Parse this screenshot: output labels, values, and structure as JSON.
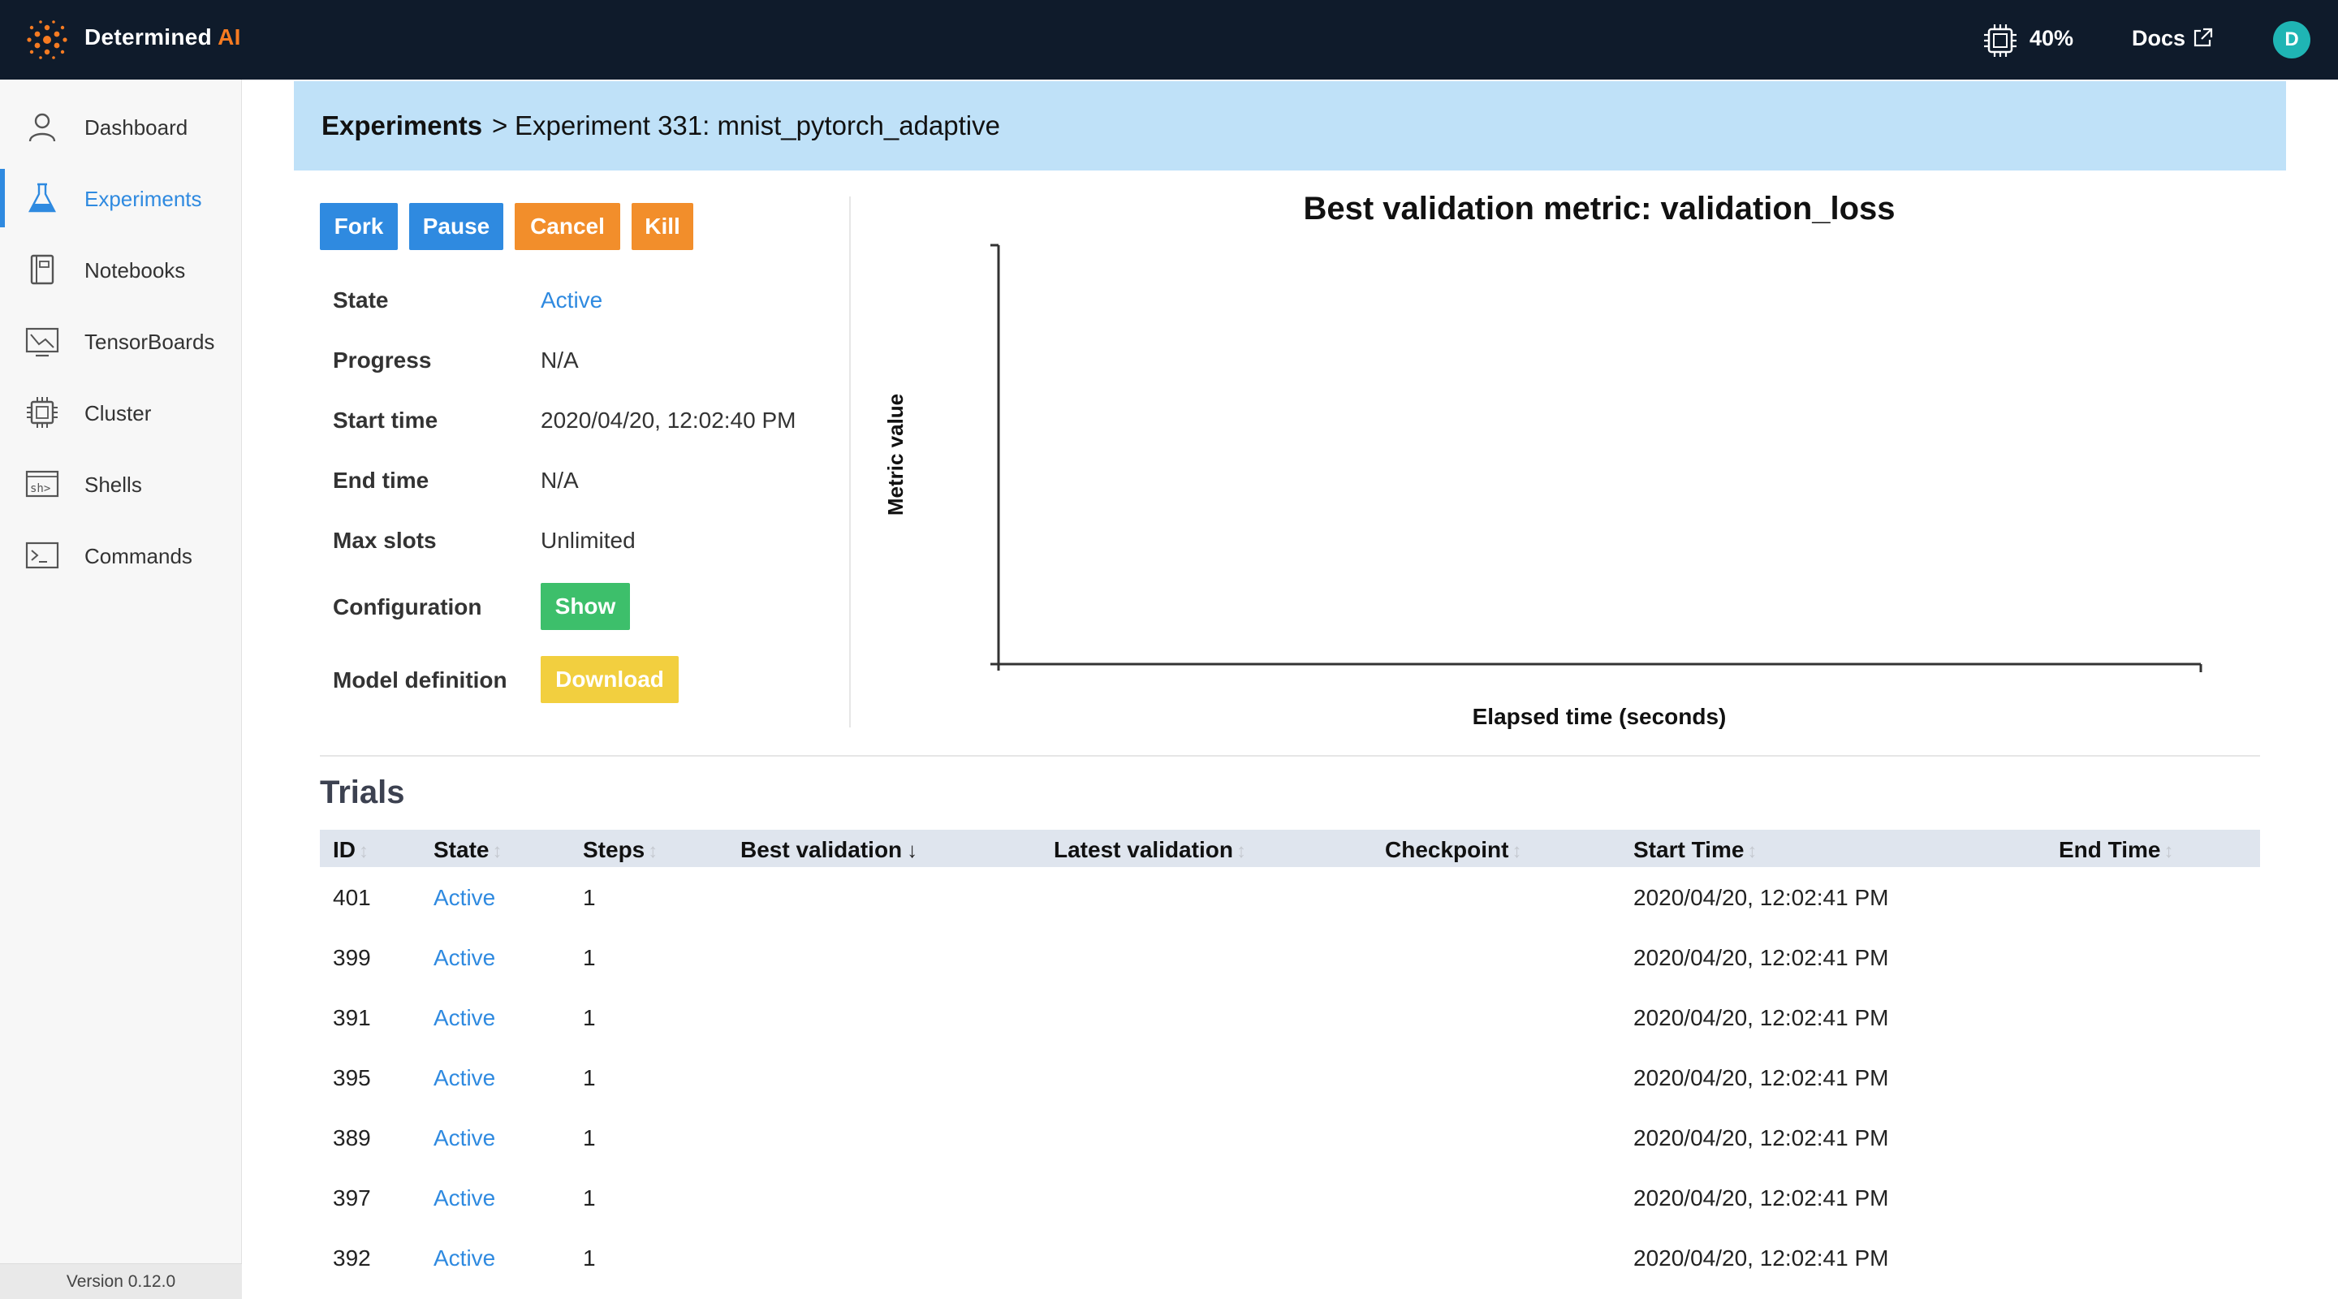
{
  "app": {
    "brand_name": "Determined",
    "brand_suffix": "AI",
    "cpu_usage": "40%",
    "docs_label": "Docs",
    "user_initial": "D",
    "accent_color": "#2f8ae0",
    "topbar_color": "#0f1b2b"
  },
  "sidebar": {
    "items": [
      {
        "label": "Dashboard",
        "icon": "user-icon",
        "active": false
      },
      {
        "label": "Experiments",
        "icon": "flask-icon",
        "active": true
      },
      {
        "label": "Notebooks",
        "icon": "notebook-icon",
        "active": false
      },
      {
        "label": "TensorBoards",
        "icon": "chart-icon",
        "active": false
      },
      {
        "label": "Cluster",
        "icon": "cpu-icon",
        "active": false
      },
      {
        "label": "Shells",
        "icon": "shell-icon",
        "active": false
      },
      {
        "label": "Commands",
        "icon": "terminal-icon",
        "active": false
      }
    ],
    "version": "Version 0.12.0"
  },
  "breadcrumb": {
    "root": "Experiments",
    "separator": ">",
    "current": "Experiment 331: mnist_pytorch_adaptive"
  },
  "actions": {
    "fork": "Fork",
    "pause": "Pause",
    "cancel": "Cancel",
    "kill": "Kill"
  },
  "info": {
    "state_label": "State",
    "state_value": "Active",
    "progress_label": "Progress",
    "progress_value": "N/A",
    "start_label": "Start time",
    "start_value": "2020/04/20, 12:02:40 PM",
    "end_label": "End time",
    "end_value": "N/A",
    "slots_label": "Max slots",
    "slots_value": "Unlimited",
    "config_label": "Configuration",
    "config_button": "Show",
    "model_label": "Model definition",
    "model_button": "Download"
  },
  "chart_data": {
    "type": "line",
    "title": "Best validation metric: validation_loss",
    "xlabel": "Elapsed time (seconds)",
    "ylabel": "Metric value",
    "series": [],
    "grid": false
  },
  "trials": {
    "title": "Trials",
    "columns": [
      "ID",
      "State",
      "Steps",
      "Best validation",
      "Latest validation",
      "Checkpoint",
      "Start Time",
      "End Time"
    ],
    "sorted_column": "Best validation",
    "rows": [
      {
        "id": "401",
        "state": "Active",
        "steps": "1",
        "start": "2020/04/20, 12:02:41 PM"
      },
      {
        "id": "399",
        "state": "Active",
        "steps": "1",
        "start": "2020/04/20, 12:02:41 PM"
      },
      {
        "id": "391",
        "state": "Active",
        "steps": "1",
        "start": "2020/04/20, 12:02:41 PM"
      },
      {
        "id": "395",
        "state": "Active",
        "steps": "1",
        "start": "2020/04/20, 12:02:41 PM"
      },
      {
        "id": "389",
        "state": "Active",
        "steps": "1",
        "start": "2020/04/20, 12:02:41 PM"
      },
      {
        "id": "397",
        "state": "Active",
        "steps": "1",
        "start": "2020/04/20, 12:02:41 PM"
      },
      {
        "id": "392",
        "state": "Active",
        "steps": "1",
        "start": "2020/04/20, 12:02:41 PM"
      }
    ]
  }
}
